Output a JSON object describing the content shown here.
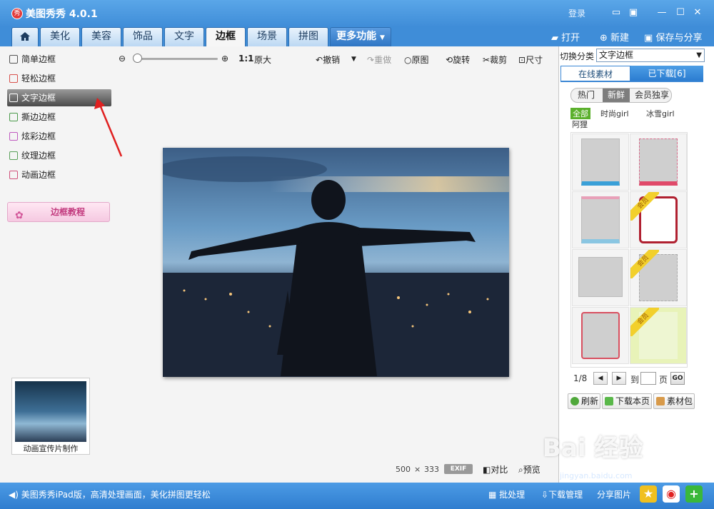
{
  "app": {
    "title": "美图秀秀 4.0.1",
    "logo_text": "秀",
    "login": "登录"
  },
  "nav": {
    "tabs": [
      "美化",
      "美容",
      "饰品",
      "文字",
      "边框",
      "场景",
      "拼图"
    ],
    "more": "更多功能",
    "open": "打开",
    "new": "新建",
    "save_share": "保存与分享"
  },
  "toolbar": {
    "zoom_one": "1:1",
    "original_size": "原大",
    "undo": "撤销",
    "redo": "重做",
    "original": "原图",
    "rotate": "旋转",
    "crop": "裁剪",
    "size": "尺寸"
  },
  "left": {
    "items": [
      "简单边框",
      "轻松边框",
      "文字边框",
      "撕边边框",
      "炫彩边框",
      "纹理边框",
      "动画边框"
    ],
    "active_index": 2,
    "tutorial": "边框教程",
    "promo": "动画宣传片制作"
  },
  "image_info": {
    "width": "500",
    "x": "×",
    "height": "333",
    "exif": "EXIF",
    "compare": "对比",
    "preview": "预览"
  },
  "right": {
    "switch_label": "切换分类",
    "category": "文字边框",
    "tab_online": "在线素材",
    "tab_downloaded": "已下载[6]",
    "pills": [
      "热门",
      "新鲜",
      "会员独享"
    ],
    "active_pill": 1,
    "filters": [
      "全部",
      "时尚girl",
      "冰雪girl",
      "阿狸"
    ],
    "member_label": "会员",
    "page": "1/8",
    "goto": "到",
    "page_unit": "页",
    "go": "GO",
    "refresh": "刷新",
    "download_page": "下载本页",
    "material_pack": "素材包"
  },
  "status": {
    "text": "美图秀秀iPad版，高清处理画面，美化拼图更轻松",
    "batch": "批处理",
    "download_mgr": "下载管理",
    "share": "分享图片"
  },
  "watermark": {
    "main": "Bai 经验",
    "sub": "jingyan.baidu.com"
  },
  "colors": {
    "title_blue": "#3f8dd8",
    "accent_red": "#e02020",
    "member_gold": "#f2d02c",
    "filter_green": "#5bb02c"
  }
}
